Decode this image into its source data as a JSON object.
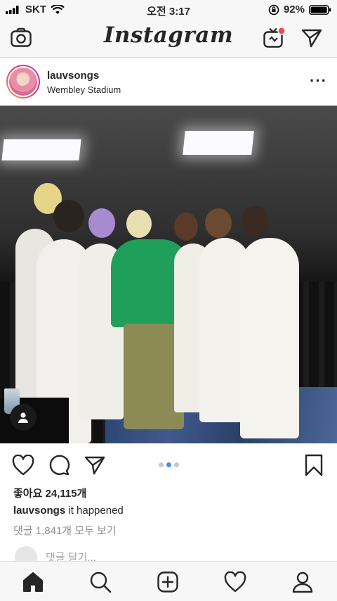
{
  "status_bar": {
    "carrier": "SKT",
    "time": "오전 3:17",
    "battery": "92%"
  },
  "top_nav": {
    "logo": "Instagram",
    "icons": [
      "camera-icon",
      "igtv-icon",
      "direct-message-icon"
    ],
    "notification_dot_color": "#ed4956"
  },
  "post": {
    "username": "lauvsongs",
    "location": "Wembley Stadium",
    "likes": "좋아요 24,115개",
    "caption_user": "lauvsongs",
    "caption_text": " it happened",
    "comments_link": "댓글 1,841개 모두 보기",
    "add_comment_placeholder": "댓글 달기...",
    "carousel": {
      "count": 3,
      "active_index": 1
    }
  },
  "colors": {
    "accent_blue": "#3897f0",
    "text": "#262626",
    "muted": "#8e8e8e",
    "bar_bg": "#f7f7f7"
  },
  "tab_bar": {
    "icons": [
      "home-icon",
      "search-icon",
      "new-post-icon",
      "activity-icon",
      "profile-icon"
    ],
    "active": "home-icon"
  }
}
